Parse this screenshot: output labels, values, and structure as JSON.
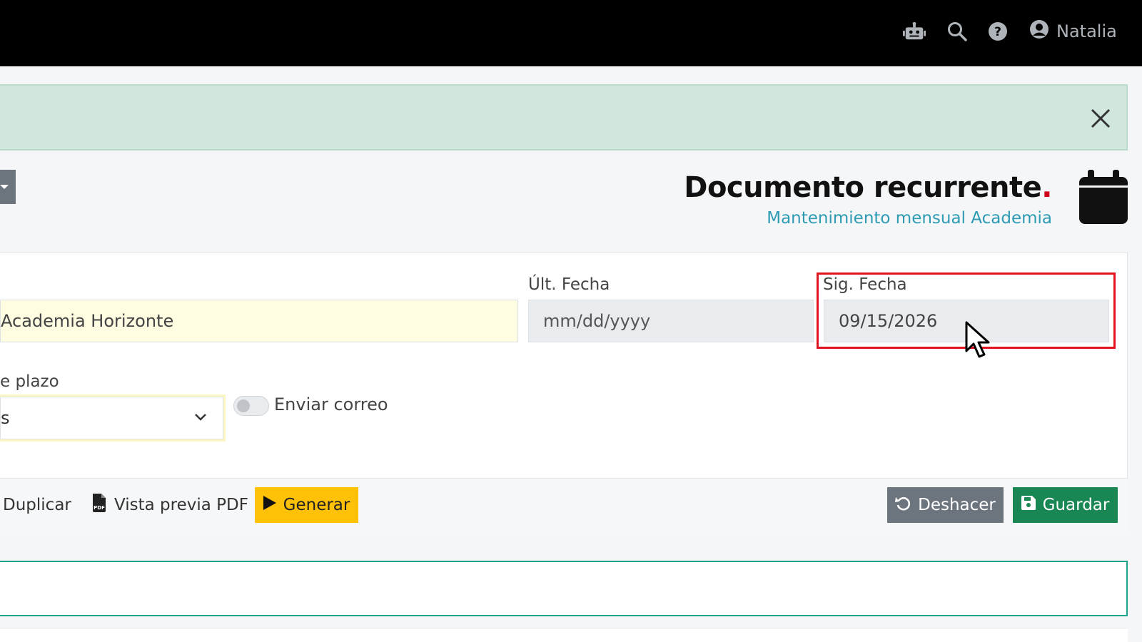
{
  "header": {
    "user_name": "Natalia",
    "icons": [
      "robot-icon",
      "search-icon",
      "help-icon",
      "user-circle-icon"
    ]
  },
  "page": {
    "title": "Documento recurrente",
    "title_dot": ".",
    "subtitle": "Mantenimiento mensual Academia"
  },
  "form": {
    "name_value": "Academia Horizonte",
    "ult_fecha_label": "Últ. Fecha",
    "ult_fecha_placeholder": "mm/dd/yyyy",
    "sig_fecha_label": "Sig. Fecha",
    "sig_fecha_value": "09/15/2026",
    "plazo_label": "e plazo",
    "plazo_value": "s",
    "enviar_correo_label": "Enviar correo",
    "enviar_correo_on": false
  },
  "actions": {
    "duplicar": "Duplicar",
    "vista_previa": "Vista previa PDF",
    "generar": "Generar",
    "deshacer": "Deshacer",
    "guardar": "Guardar"
  },
  "colors": {
    "accent_teal": "#2e9bb3",
    "generate": "#ffc107",
    "save": "#198754",
    "undo": "#6c757d",
    "alert_bg": "#d1e7dd",
    "highlight": "#e0141e"
  }
}
